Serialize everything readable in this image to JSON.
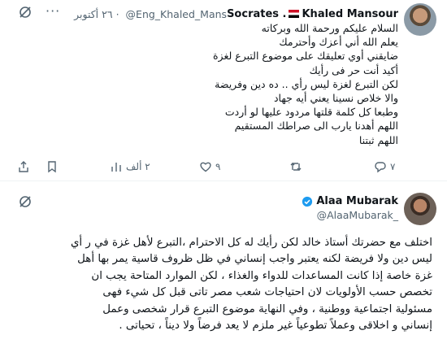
{
  "tweet1": {
    "display_name": "Socrates .",
    "display_name_suffix": "Khaled Mansour",
    "handle": "@Eng_Khaled_Mans",
    "separator": "·",
    "date": "٢٦ أكتوبر",
    "lines": [
      "السلام عليكم ورحمة الله وبركاته",
      "يعلم الله أني أعزك وأحترمك",
      "ضايقني أوي تعليقك على موضوع التبرع لغزة",
      "أكيد أنت حر فى رأيك",
      "لكن التبرع لغزة ليس رأي .. ده دين وفريضة",
      "والا خلاص نسينا يعني أيه جهاد",
      "وطبعا كل كلمة قلتها مردود عليها لو أردت",
      "اللهم أهدنا يارب الى صراطك المستقيم",
      "اللهم ثبتنا"
    ],
    "actions": {
      "reply_count": "٧",
      "retweet_count": "",
      "like_count": "٩",
      "views_count": "٢ ألف"
    }
  },
  "tweet2": {
    "display_name": "Alaa Mubarak",
    "handle": "@AlaaMubarak_",
    "lines": [
      "اختلف مع حضرتك أستاذ خالد لكن رأيك له كل الاحترام ،التبرع لأهل غزة في ر أي",
      "ليس دين ولا فريضة لكنه يعتبر واجب إنساني  في ظل ظروف قاسية يمر بها أهل",
      "غزة خاصة إذا كانت المساعدات للدواء والغذاء ، لكن الموارد المتاحة يجب ان",
      "تخصص حسب الأولويات لان احتياجات شعب مصر تاتى قبل كل شيء فهى",
      "مسئولية اجتماعية ووطنية ،  وفي النهاية موضوع التبرع قرار شخصى وعمل",
      "إنساني و اخلاقى وعملاً تطوعياً غير ملزم لا يعد فرضاً ولا ديناً ، تحياتى ."
    ]
  },
  "icons": {
    "grok": "grok-icon",
    "more": "more-dots-icon",
    "verified": "verified-badge-icon",
    "reply": "reply-icon",
    "retweet": "retweet-icon",
    "like": "like-icon",
    "views": "views-icon",
    "bookmark": "bookmark-icon",
    "share": "share-icon"
  },
  "colors": {
    "text": "#0f1419",
    "secondary": "#536471",
    "verified": "#1d9bf0",
    "divider": "#eff3f4"
  }
}
